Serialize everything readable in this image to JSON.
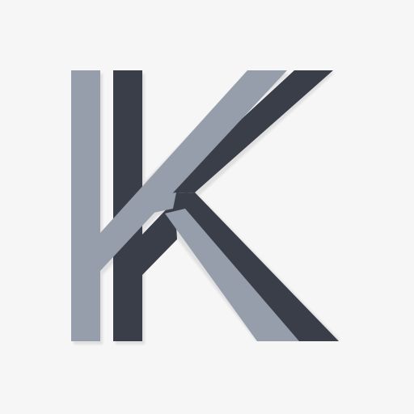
{
  "logo": {
    "name": "K-monogram",
    "colors": {
      "background": "#f6f6f6",
      "light_stroke": "#969dab",
      "dark_stroke": "#3a3e48",
      "shadow": "#dcdcdc"
    }
  }
}
